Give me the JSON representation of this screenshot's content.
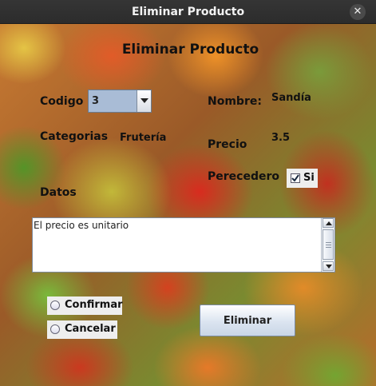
{
  "window": {
    "title": "Eliminar Producto",
    "close_symbol": "✕"
  },
  "form": {
    "heading": "Eliminar Producto",
    "codigo_label": "Codigo",
    "codigo_value": "3",
    "nombre_label": "Nombre:",
    "nombre_value": "Sandía",
    "categorias_label": "Categorias",
    "categorias_value": "Frutería",
    "precio_label": "Precio",
    "precio_value": "3.5",
    "perecedero_label": "Perecedero",
    "perecedero_checkbox_label": "Si",
    "perecedero_checked": true,
    "datos_label": "Datos",
    "datos_text": "El precio es unitario",
    "radio_confirmar": "Confirmar",
    "radio_cancelar": "Cancelar",
    "eliminar_button": "Eliminar"
  },
  "icons": {
    "close": "close-icon",
    "combo_arrow": "chevron-down-icon",
    "check": "check-icon",
    "scroll_up": "arrow-up-icon",
    "scroll_down": "arrow-down-icon"
  }
}
